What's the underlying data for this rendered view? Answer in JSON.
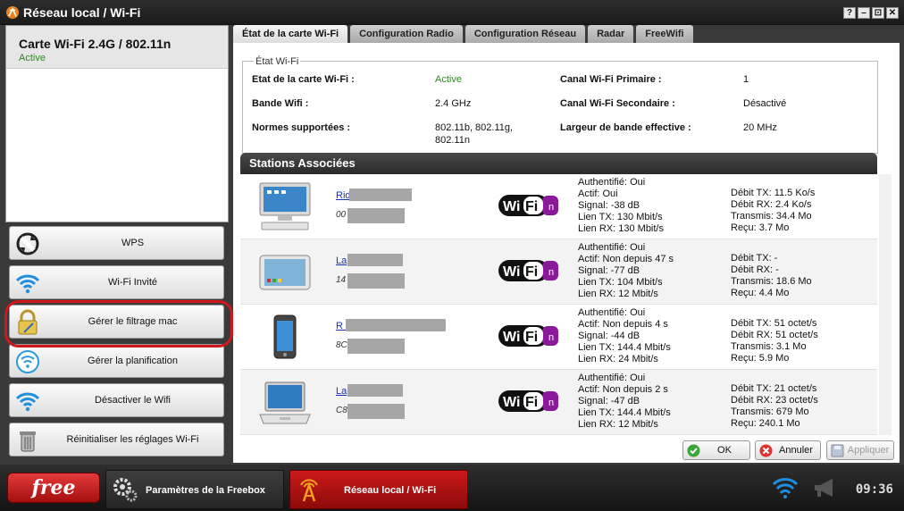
{
  "window": {
    "title": "Réseau local / Wi-Fi",
    "buttons": [
      "?",
      "–",
      "⊡",
      "✕"
    ]
  },
  "sidebar": {
    "card_title": "Carte Wi-Fi 2.4G / 802.11n",
    "card_status": "Active",
    "buttons": [
      {
        "label": "WPS",
        "icon": "wps-icon"
      },
      {
        "label": "Wi-Fi Invité",
        "icon": "wifi-guest-icon"
      },
      {
        "label": "Gérer le filtrage mac",
        "icon": "lock-icon",
        "highlighted": true
      },
      {
        "label": "Gérer la planification",
        "icon": "schedule-wifi-icon"
      },
      {
        "label": "Désactiver le Wifi",
        "icon": "wifi-off-icon"
      },
      {
        "label": "Réinitialiser les réglages Wi-Fi",
        "icon": "trash-icon"
      }
    ]
  },
  "tabs": [
    {
      "label": "État de la carte Wi-Fi",
      "active": true
    },
    {
      "label": "Configuration Radio",
      "active": false
    },
    {
      "label": "Configuration Réseau",
      "active": false
    },
    {
      "label": "Radar",
      "active": false
    },
    {
      "label": "FreeWifi",
      "active": false
    }
  ],
  "state": {
    "legend": "État Wi-Fi",
    "etat_label": "Etat de la carte Wi-Fi :",
    "etat_value": "Active",
    "bande_label": "Bande Wifi :",
    "bande_value": "2.4 GHz",
    "normes_label": "Normes supportées :",
    "normes_value1": "802.11b, 802.11g,",
    "normes_value2": "802.11n",
    "canal1_label": "Canal Wi-Fi Primaire :",
    "canal1_value": "1",
    "canal2_label": "Canal Wi-Fi Secondaire :",
    "canal2_value": "Désactivé",
    "largeur_label": "Largeur de bande effective :",
    "largeur_value": "20 MHz"
  },
  "stations_header": "Stations Associées",
  "stations": [
    {
      "device": "desktop",
      "name": "Rid             wifi",
      "mac": "00              43",
      "info": [
        "Authentifié: Oui",
        "Actif: Oui",
        "Signal: -38 dB",
        "Lien TX: 130 Mbit/s",
        "Lien RX: 130 Mbit/s"
      ],
      "rates": [
        "Débit TX: 11.5 Ko/s",
        "Débit RX: 2.4 Ko/s",
        "Transmis: 34.4 Mo",
        "Reçu: 3.7 Mo"
      ]
    },
    {
      "device": "tablet",
      "name": "La",
      "mac": "14              96",
      "info": [
        "Authentifié: Oui",
        "Actif: Non depuis 47 s",
        "Signal: -77 dB",
        "Lien TX: 104 Mbit/s",
        "Lien RX: 12 Mbit/s"
      ],
      "rates": [
        "Débit TX: -",
        "Débit RX: -",
        "Transmis: 18.6 Mo",
        "Reçu: 4.4 Mo"
      ]
    },
    {
      "device": "phone",
      "name": "R                              7",
      "mac": "8C              7B",
      "info": [
        "Authentifié: Oui",
        "Actif: Non depuis 4 s",
        "Signal: -44 dB",
        "Lien TX: 144.4 Mbit/s",
        "Lien RX: 24 Mbit/s"
      ],
      "rates": [
        "Débit TX: 51 octet/s",
        "Débit RX: 51 octet/s",
        "Transmis: 3.1 Mo",
        "Reçu: 5.9 Mo"
      ]
    },
    {
      "device": "laptop",
      "name": "La",
      "mac": "C8              16",
      "info": [
        "Authentifié: Oui",
        "Actif: Non depuis 2 s",
        "Signal: -47 dB",
        "Lien TX: 144.4 Mbit/s",
        "Lien RX: 12 Mbit/s"
      ],
      "rates": [
        "Débit TX: 21 octet/s",
        "Débit RX: 23 octet/s",
        "Transmis: 679 Mo",
        "Reçu: 240.1 Mo"
      ]
    }
  ],
  "wifi_logo_text": {
    "wi": "Wi",
    "fi": "Fi",
    "n": "n"
  },
  "actions": {
    "ok": "OK",
    "cancel": "Annuler",
    "apply": "Appliquer"
  },
  "taskbar": {
    "free_label": "free",
    "item1": "Paramètres de la Freebox",
    "item2": "Réseau local / Wi-Fi",
    "clock": "09:36"
  },
  "colors": {
    "active_green": "#2a8a1c",
    "link_blue": "#1a2fb5",
    "highlight_red": "#d0181c",
    "task_red": "#cc1a1a"
  }
}
